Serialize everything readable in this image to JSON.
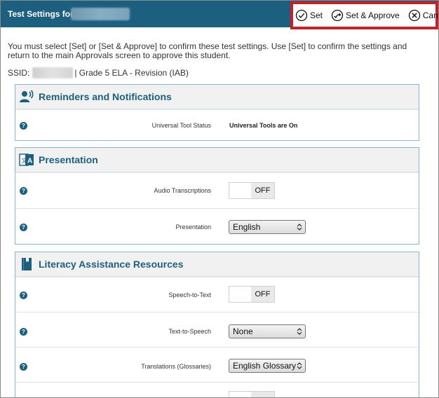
{
  "header": {
    "title": "Test Settings for:",
    "actions": [
      {
        "label": "Set",
        "icon": "check-circle-icon"
      },
      {
        "label": "Set & Approve",
        "icon": "check-arrow-circle-icon"
      },
      {
        "label": "Cancel",
        "icon": "x-circle-icon"
      }
    ]
  },
  "intro": {
    "text": "You must select [Set] or [Set & Approve] to confirm these test settings. Use [Set] to confirm the settings and return to the main Approvals screen to approve this student."
  },
  "ssid": {
    "label": "SSID:",
    "test": "| Grade 5 ELA - Revision (IAB)"
  },
  "sections": [
    {
      "title": "Reminders and Notifications",
      "icon": "speaker-person-icon",
      "rows": [
        {
          "label": "Universal Tool Status",
          "value": "Universal Tools are On"
        }
      ]
    },
    {
      "title": "Presentation",
      "icon": "language-icon",
      "rows": [
        {
          "label": "Audio Transcriptions",
          "toggle": "OFF"
        },
        {
          "label": "Presentation",
          "select": "English"
        }
      ]
    },
    {
      "title": "Literacy Assistance Resources",
      "icon": "book-icon",
      "rows": [
        {
          "label": "Speech-to-Text",
          "toggle": "OFF"
        },
        {
          "label": "Text-to-Speech",
          "select": "None"
        },
        {
          "label": "Translations (Glossaries)",
          "select": "English Glossary"
        }
      ]
    }
  ],
  "colors": {
    "header_bg": "#1d5f7f",
    "highlight_border": "#c0232c",
    "section_title": "#1d5f7f"
  }
}
